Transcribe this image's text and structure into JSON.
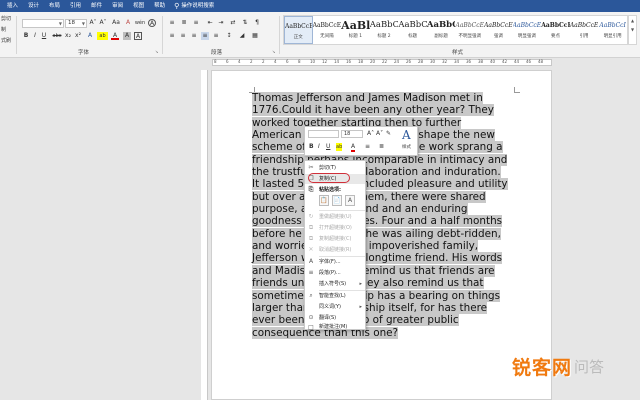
{
  "menubar": {
    "tabs": [
      "插入",
      "设计",
      "布局",
      "引用",
      "邮件",
      "审阅",
      "视图",
      "帮助"
    ],
    "tell_me": "操作说明搜索"
  },
  "ribbon": {
    "clipboard": {
      "cut": "剪切",
      "format_painter": "式刷"
    },
    "font": {
      "font_name": "",
      "font_size": "18",
      "grow": "A˄",
      "shrink": "A˅",
      "case": "Aa",
      "clear": "A",
      "phonetic": "wén",
      "enclose": "A",
      "bold": "B",
      "italic": "I",
      "underline": "U",
      "strike": "abc",
      "subscript": "x₂",
      "superscript": "x²",
      "effects": "A",
      "highlight": "ab",
      "font_color": "A",
      "shade": "A",
      "char_border": "A",
      "group_label": "字体"
    },
    "paragraph": {
      "group_label": "段落"
    },
    "styles": {
      "group_label": "样式",
      "items": [
        {
          "sample": "AaBbCcE",
          "name": "正文"
        },
        {
          "sample": "AaBbCcE",
          "name": "无间隔"
        },
        {
          "sample": "AaBl",
          "name": "标题 1"
        },
        {
          "sample": "AaBbC",
          "name": "标题 2"
        },
        {
          "sample": "AaBbC",
          "name": "标题"
        },
        {
          "sample": "AaBbC",
          "name": "副标题"
        },
        {
          "sample": "AaBbCcE",
          "name": "不明显强调"
        },
        {
          "sample": "AaBbCcE",
          "name": "强调"
        },
        {
          "sample": "AaBbCcE",
          "name": "明显强调"
        },
        {
          "sample": "AaBbCcE",
          "name": "要点"
        },
        {
          "sample": "AaBbCcE",
          "name": "引用"
        },
        {
          "sample": "AaBbCcI",
          "name": "明显引用"
        }
      ]
    }
  },
  "ruler": {
    "numbers": [
      "8",
      "6",
      "4",
      "2",
      "2",
      "4",
      "6",
      "8",
      "10",
      "12",
      "14",
      "16",
      "18",
      "20",
      "22",
      "24",
      "26",
      "28",
      "30",
      "32",
      "34",
      "36",
      "38",
      "40",
      "42",
      "44",
      "46",
      "48"
    ]
  },
  "document": {
    "lines": [
      "Thomas Jefferson and James Madison met in",
      "1776.Could it have been any other year? They",
      "worked together starting then to further",
      "American independence and to shape the new",
      "scheme of government. From the work sprang a",
      "friendship perhaps incomparable in intimacy and",
      "the trustfulness of collaboration and induration.",
      "It lasted 50 years. It included pleasure and utility",
      "but over and above them, there were shared",
      "purpose, a common end and an enduring",
      "goodness on both sides. Four and a half months",
      "before he died, when he was ailing debt-ridden,",
      "and worried about his impoverished family,",
      "Jefferson wrote to his longtime friend. His words",
      "and Madison's reply remind us that friends are",
      "friends until death. They also remind us that",
      "sometimes a friendship has a bearing on things",
      "larger than the friendship itself, for has there",
      "ever been a friendship of greater public",
      "consequence than this one?"
    ]
  },
  "minibar": {
    "font_name": "",
    "font_size": "18",
    "grow": "A˄",
    "shrink": "A˅",
    "painter": "✎",
    "bold": "B",
    "italic": "I",
    "underline": "U",
    "highlight": "ab",
    "font_color": "A",
    "bullets": "≡",
    "numbering": "≣",
    "styles_icon": "A",
    "styles_label": "样式"
  },
  "context_menu": {
    "items": [
      {
        "label": "剪切(T)",
        "icon": "✂"
      },
      {
        "label": "复制(C)",
        "icon": "❐"
      },
      {
        "label": "粘贴选项:",
        "icon": "⎘"
      },
      {
        "label": "",
        "icon": ""
      },
      {
        "label": "重做超链接(U)",
        "icon": "↻"
      },
      {
        "label": "打开超链接(O)",
        "icon": "⧉"
      },
      {
        "label": "复制超链接(C)",
        "icon": "⧉"
      },
      {
        "label": "取消超链接(R)",
        "icon": "✕"
      },
      {
        "label": "字体(F)...",
        "icon": "A"
      },
      {
        "label": "段落(P)...",
        "icon": "≡"
      },
      {
        "label": "插入符号(S)",
        "icon": ""
      },
      {
        "label": "智能查找(L)",
        "icon": "⌕"
      },
      {
        "label": "同义词(Y)",
        "icon": ""
      },
      {
        "label": "翻译(S)",
        "icon": "⊙"
      },
      {
        "label": "新建批注(M)",
        "icon": "□"
      }
    ],
    "paste_icons": [
      "📋",
      "📄",
      "A"
    ]
  },
  "watermark": {
    "text": "锐客网",
    "ask": "问答"
  },
  "colors": {
    "ribbon_blue": "#2b579a",
    "selection_gray": "#c8c8c8",
    "watermark_orange": "#f07a10",
    "circle_red": "#d0303a"
  }
}
